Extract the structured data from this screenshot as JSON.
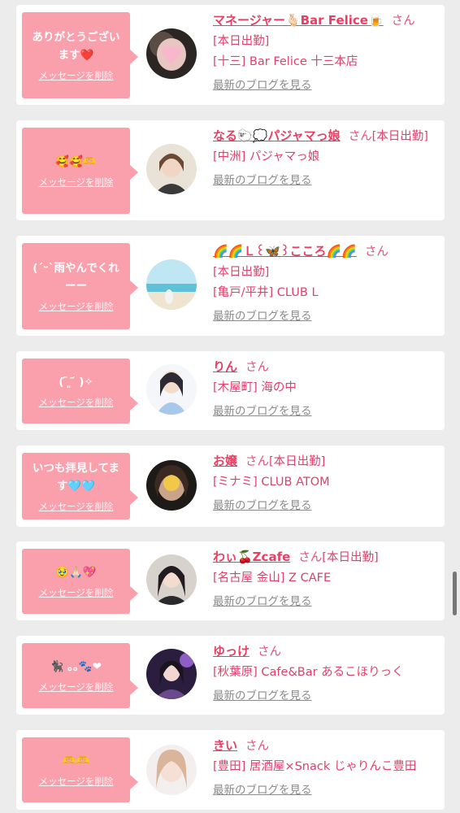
{
  "delete_label": "メッセージを削除",
  "san_label": "さん",
  "blog_label": "最新のブログを見る",
  "colors": {
    "accent": "#e83f63",
    "bubble": "#fa9fac",
    "background": "#ececec"
  },
  "cards": [
    {
      "message": "ありがとうございます❤️",
      "name": "マネージャー🫰🏻Bar Felice🍺",
      "status": "[本日出勤]",
      "shop": "[十三] Bar Felice 十三本店"
    },
    {
      "message": "🥰🥰🫶",
      "name": "なる🐑💭パジャマっ娘",
      "status": "[本日出勤]",
      "shop": "[中洲] パジャマっ娘"
    },
    {
      "message": "(ˊᵕˋ雨やんでくれーー",
      "name": "🌈🌈Ｌ꒰🦋꒱こころ🌈🌈",
      "status": "[本日出勤]",
      "shop": "[亀戸/平井] CLUB L"
    },
    {
      "message": "( ᷇ ͈ ᷄ )✧",
      "name": "りん",
      "status": "",
      "shop": "[木屋町] 海の中"
    },
    {
      "message": "いつも拝見してます🩵🩵",
      "name": "お嬢",
      "status": "[本日出勤]",
      "shop": "[ミナミ] CLUB ATOM"
    },
    {
      "message": "🥹🙏🏻💖",
      "name": "わぃ🍒Zcafe",
      "status": "[本日出勤]",
      "shop": "[名古屋 金山] Z CAFE"
    },
    {
      "message": "🐈‍⬛ ｡｡🐾❤",
      "name": "ゆっけ",
      "status": "",
      "shop": "[秋葉原] Cafe&Bar あるこほりっく"
    },
    {
      "message": "🫶🫶",
      "name": "きい",
      "status": "",
      "shop": "[豊田] 居酒屋×Snack じゃりんこ豊田"
    }
  ]
}
